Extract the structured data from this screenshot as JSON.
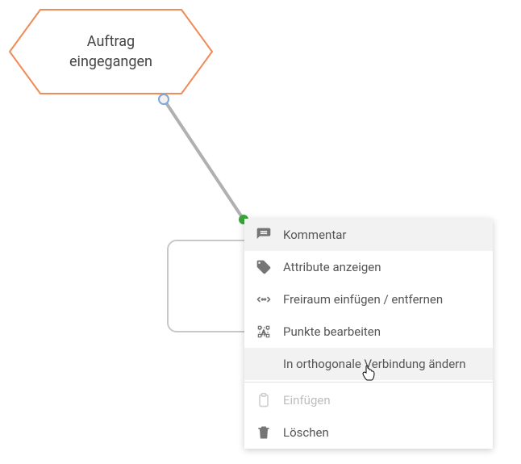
{
  "node": {
    "label_line1": "Auftrag",
    "label_line2": "eingegangen"
  },
  "menu": {
    "items": [
      {
        "id": "comment",
        "label": "Kommentar",
        "icon": "comment-icon",
        "hover": true,
        "disabled": false
      },
      {
        "id": "attributes",
        "label": "Attribute anzeigen",
        "icon": "tag-icon",
        "hover": false,
        "disabled": false
      },
      {
        "id": "freespace",
        "label": "Freiraum einfügen / entfernen",
        "icon": "arrows-h-icon",
        "hover": false,
        "disabled": false
      },
      {
        "id": "points",
        "label": "Punkte bearbeiten",
        "icon": "edit-points-icon",
        "hover": false,
        "disabled": false
      },
      {
        "id": "orthogonal",
        "label": "In orthogonale Verbindung ändern",
        "icon": "",
        "hover": true,
        "disabled": false
      },
      {
        "id": "divider",
        "divider": true
      },
      {
        "id": "paste",
        "label": "Einfügen",
        "icon": "clipboard-icon",
        "hover": false,
        "disabled": true
      },
      {
        "id": "delete",
        "label": "Löschen",
        "icon": "trash-icon",
        "hover": false,
        "disabled": false
      }
    ]
  }
}
